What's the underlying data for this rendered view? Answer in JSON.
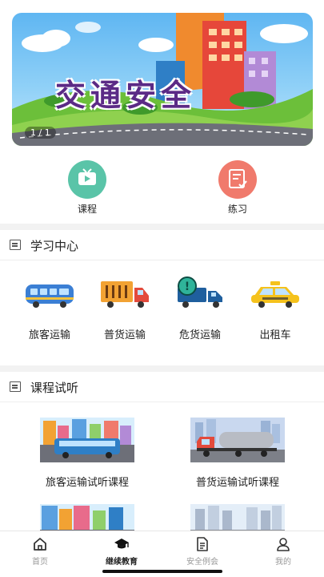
{
  "banner": {
    "title": "交通安全",
    "indicator": "1 / 1"
  },
  "quick_entries": [
    {
      "label": "课程",
      "icon": "tv-icon",
      "color": "#5ac4a8"
    },
    {
      "label": "练习",
      "icon": "checklist-icon",
      "color": "#f07a6c"
    }
  ],
  "study_center": {
    "title": "学习中心",
    "categories": [
      {
        "label": "旅客运输",
        "icon": "bus-icon"
      },
      {
        "label": "普货运输",
        "icon": "truck-icon"
      },
      {
        "label": "危货运输",
        "icon": "hazard-truck-icon"
      },
      {
        "label": "出租车",
        "icon": "taxi-icon"
      }
    ]
  },
  "course_preview": {
    "title": "课程试听",
    "courses": [
      {
        "label": "旅客运输试听课程"
      },
      {
        "label": "普货运输试听课程"
      },
      {
        "label": ""
      },
      {
        "label": ""
      }
    ]
  },
  "tabbar": {
    "tabs": [
      {
        "label": "首页",
        "icon": "home-icon",
        "active": false
      },
      {
        "label": "继续教育",
        "icon": "graduation-cap-icon",
        "active": true
      },
      {
        "label": "安全例会",
        "icon": "document-icon",
        "active": false
      },
      {
        "label": "我的",
        "icon": "user-icon",
        "active": false
      }
    ]
  },
  "colors": {
    "accent_green": "#5ac4a8",
    "accent_red": "#f07a6c",
    "divider": "#f2f2f2"
  }
}
